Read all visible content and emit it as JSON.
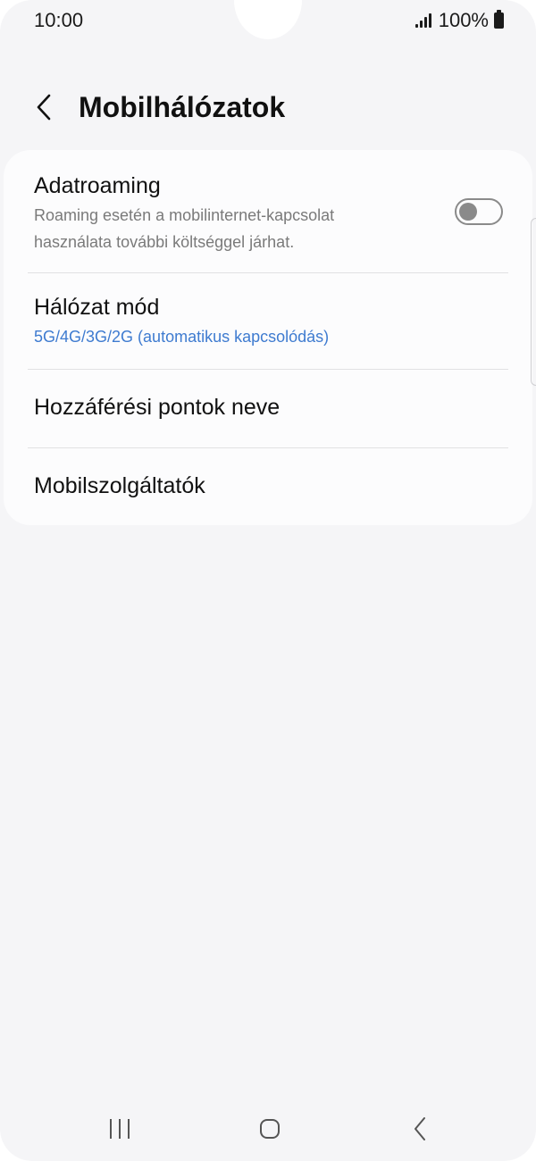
{
  "status_bar": {
    "time": "10:00",
    "battery_text": "100%",
    "icons": [
      "signal-icon",
      "battery-icon"
    ]
  },
  "header": {
    "back_icon": "chevron-left-icon",
    "title": "Mobilhálózatok"
  },
  "settings": {
    "data_roaming": {
      "title": "Adatroaming",
      "description_line1": "Roaming esetén a mobilinternet-kapcsolat",
      "description_line2": "használata további költséggel járhat.",
      "enabled": false
    },
    "network_mode": {
      "title": "Hálózat mód",
      "value": "5G/4G/3G/2G (automatikus kapcsolódás)"
    },
    "access_point_names": {
      "title": "Hozzáférési pontok neve"
    },
    "network_operators": {
      "title": "Mobilszolgáltatók"
    }
  },
  "nav_bar": {
    "icons": [
      "recents-icon",
      "home-icon",
      "back-icon"
    ]
  },
  "colors": {
    "background": "#f5f5f7",
    "card": "#fcfcfd",
    "accent_blue": "#3e7bd0",
    "secondary_text": "#7a7a7a",
    "toggle_off": "#8a8a8a"
  }
}
